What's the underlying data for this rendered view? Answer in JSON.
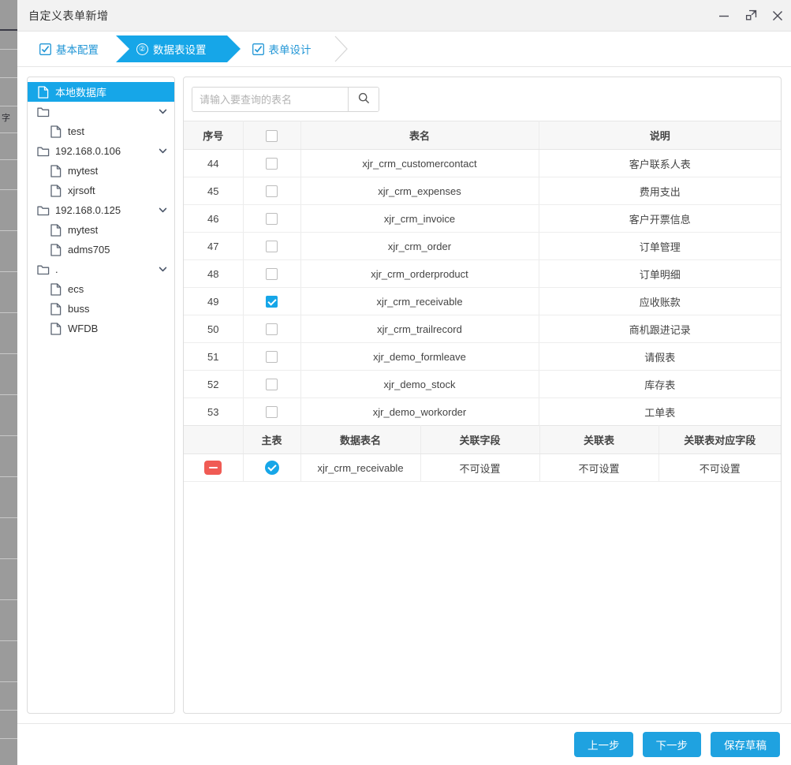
{
  "window": {
    "title": "自定义表单新增",
    "controls": [
      {
        "name": "minimize-button",
        "glyph": "minimize"
      },
      {
        "name": "maximize-button",
        "glyph": "maximize"
      },
      {
        "name": "close-button",
        "glyph": "close"
      }
    ]
  },
  "steps": [
    {
      "label": "基本配置",
      "icon": "checkbox-checked-icon",
      "state": "done",
      "number": ""
    },
    {
      "label": "数据表设置",
      "icon": "circle-number-icon",
      "state": "active",
      "number": "②"
    },
    {
      "label": "表单设计",
      "icon": "checkbox-checked-icon",
      "state": "pending",
      "number": ""
    }
  ],
  "tree": {
    "items": [
      {
        "label": "本地数据库",
        "icon": "file-icon",
        "level": 0,
        "selected": true,
        "chevron": false
      },
      {
        "label": "",
        "icon": "folder-icon",
        "level": 0,
        "selected": false,
        "chevron": true
      },
      {
        "label": "test",
        "icon": "file-icon",
        "level": 1,
        "selected": false,
        "chevron": false
      },
      {
        "label": "192.168.0.106",
        "icon": "folder-icon",
        "level": 0,
        "selected": false,
        "chevron": true
      },
      {
        "label": "mytest",
        "icon": "file-icon",
        "level": 1,
        "selected": false,
        "chevron": false
      },
      {
        "label": "xjrsoft",
        "icon": "file-icon",
        "level": 1,
        "selected": false,
        "chevron": false
      },
      {
        "label": "192.168.0.125",
        "icon": "folder-icon",
        "level": 0,
        "selected": false,
        "chevron": true
      },
      {
        "label": "mytest",
        "icon": "file-icon",
        "level": 1,
        "selected": false,
        "chevron": false
      },
      {
        "label": "adms705",
        "icon": "file-icon",
        "level": 1,
        "selected": false,
        "chevron": false
      },
      {
        "label": ".",
        "icon": "folder-icon",
        "level": 0,
        "selected": false,
        "chevron": true
      },
      {
        "label": "ecs",
        "icon": "file-icon",
        "level": 1,
        "selected": false,
        "chevron": false
      },
      {
        "label": "buss",
        "icon": "file-icon",
        "level": 1,
        "selected": false,
        "chevron": false
      },
      {
        "label": "WFDB",
        "icon": "file-icon",
        "level": 1,
        "selected": false,
        "chevron": false
      }
    ]
  },
  "search": {
    "placeholder": "请输入要查询的表名",
    "value": "",
    "button_icon": "search-icon"
  },
  "tables_grid": {
    "headers": [
      "序号",
      "",
      "表名",
      "说明"
    ],
    "header_checkbox_checked": false,
    "rows": [
      {
        "seq": "44",
        "checked": false,
        "name": "xjr_crm_customercontact",
        "desc": "客户联系人表"
      },
      {
        "seq": "45",
        "checked": false,
        "name": "xjr_crm_expenses",
        "desc": "费用支出"
      },
      {
        "seq": "46",
        "checked": false,
        "name": "xjr_crm_invoice",
        "desc": "客户开票信息"
      },
      {
        "seq": "47",
        "checked": false,
        "name": "xjr_crm_order",
        "desc": "订单管理"
      },
      {
        "seq": "48",
        "checked": false,
        "name": "xjr_crm_orderproduct",
        "desc": "订单明细"
      },
      {
        "seq": "49",
        "checked": true,
        "name": "xjr_crm_receivable",
        "desc": "应收账款"
      },
      {
        "seq": "50",
        "checked": false,
        "name": "xjr_crm_trailrecord",
        "desc": "商机跟进记录"
      },
      {
        "seq": "51",
        "checked": false,
        "name": "xjr_demo_formleave",
        "desc": "请假表"
      },
      {
        "seq": "52",
        "checked": false,
        "name": "xjr_demo_stock",
        "desc": "库存表"
      },
      {
        "seq": "53",
        "checked": false,
        "name": "xjr_demo_workorder",
        "desc": "工单表"
      }
    ]
  },
  "relation_grid": {
    "headers": [
      "",
      "主表",
      "数据表名",
      "关联字段",
      "关联表",
      "关联表对应字段"
    ],
    "rows": [
      {
        "remove_icon": "minus-circle-icon",
        "is_main": true,
        "table_name": "xjr_crm_receivable",
        "relation_field": "不可设置",
        "relation_table": "不可设置",
        "relation_target_field": "不可设置"
      }
    ]
  },
  "footer": {
    "buttons": [
      {
        "label": "上一步",
        "name": "prev-step-button"
      },
      {
        "label": "下一步",
        "name": "next-step-button"
      },
      {
        "label": "保存草稿",
        "name": "save-draft-button"
      }
    ]
  },
  "colors": {
    "accent": "#16a6e8",
    "button": "#1fa2e0",
    "danger": "#f05b54",
    "header_bg": "#f7f7f7",
    "titlebar_bg": "#f2f2f2"
  }
}
